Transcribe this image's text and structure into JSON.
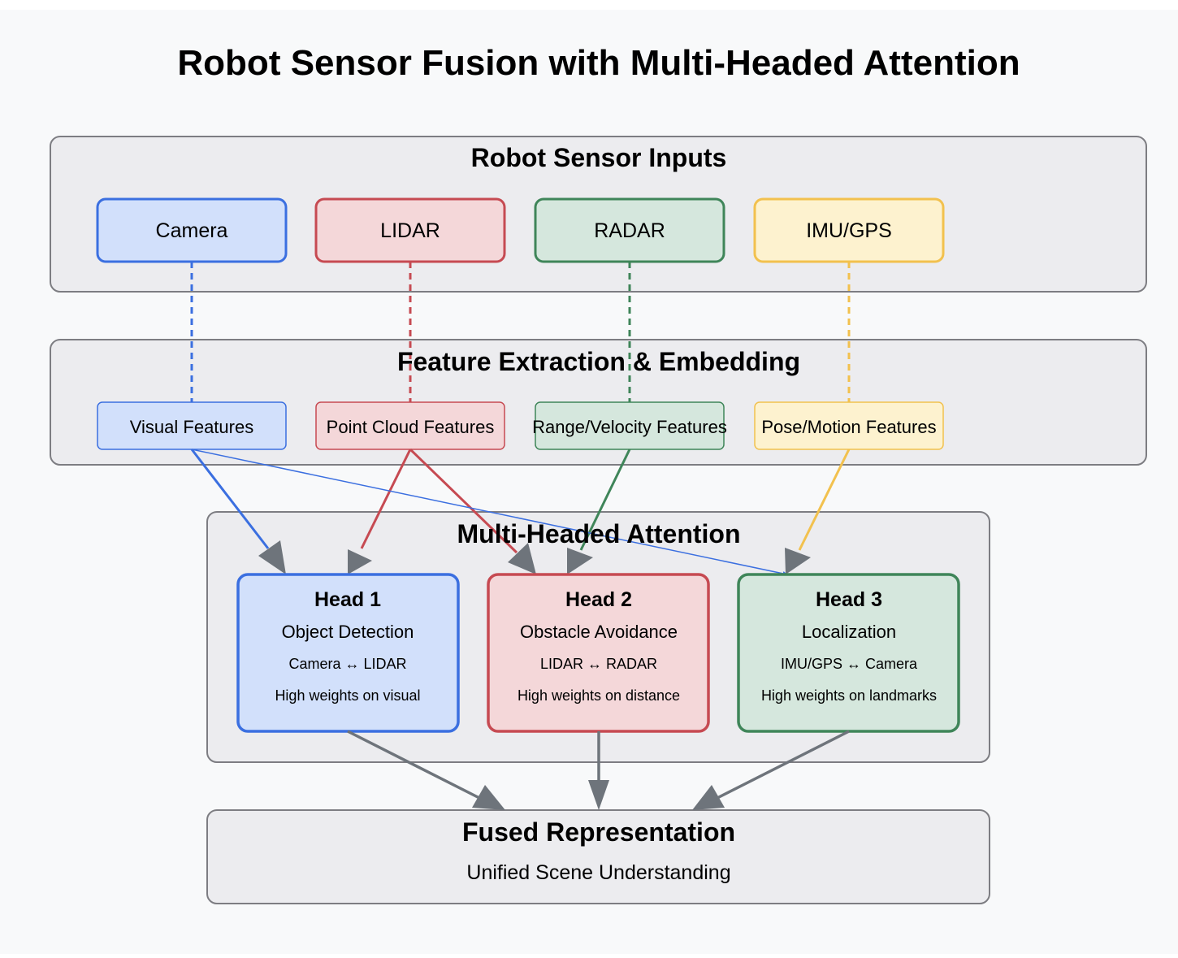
{
  "title": "Robot Sensor Fusion with Multi-Headed Attention",
  "colors": {
    "blue": "#3b6fe0",
    "blue_fill": "#d2e0fb",
    "red": "#c64a52",
    "red_fill": "#f4d7d9",
    "green": "#3f8559",
    "green_fill": "#d5e7dd",
    "yellow": "#f2c14e",
    "yellow_fill": "#fdf2cf",
    "gray": "#6e747b",
    "panel_fill": "#ececef"
  },
  "sections": {
    "inputs": "Robot Sensor Inputs",
    "features": "Feature Extraction & Embedding",
    "attention": "Multi-Headed Attention"
  },
  "sensors": [
    {
      "label": "Camera"
    },
    {
      "label": "LIDAR"
    },
    {
      "label": "RADAR"
    },
    {
      "label": "IMU/GPS"
    }
  ],
  "features": [
    {
      "label": "Visual Features"
    },
    {
      "label": "Point Cloud Features"
    },
    {
      "label": "Range/Velocity Features"
    },
    {
      "label": "Pose/Motion Features"
    }
  ],
  "heads": [
    {
      "title": "Head 1",
      "role": "Object Detection",
      "pair": "Camera ↔ LIDAR",
      "note": "High weights on visual"
    },
    {
      "title": "Head 2",
      "role": "Obstacle Avoidance",
      "pair": "LIDAR ↔ RADAR",
      "note": "High weights on distance"
    },
    {
      "title": "Head 3",
      "role": "Localization",
      "pair": "IMU/GPS ↔ Camera",
      "note": "High weights on landmarks"
    }
  ],
  "fused": {
    "title": "Fused Representation",
    "subtitle": "Unified Scene Understanding"
  }
}
